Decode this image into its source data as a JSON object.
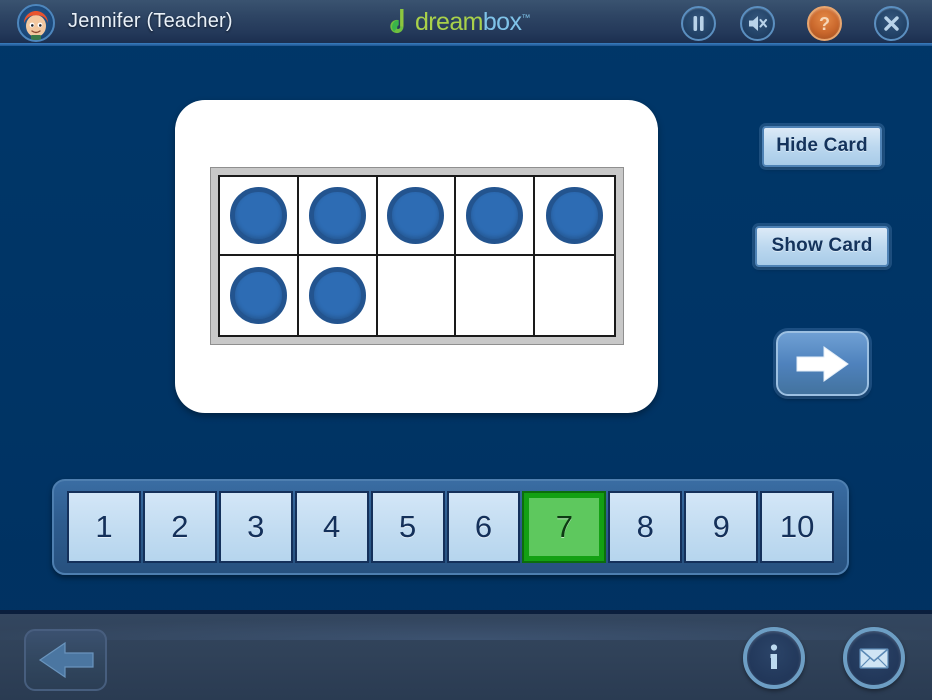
{
  "header": {
    "avatar_icon": "student-avatar-icon",
    "user_name": "Jennifer (Teacher)",
    "logo": {
      "mark_icon": "dreambox-d-icon",
      "text_dream": "dream",
      "text_box": "box",
      "trademark": "™"
    },
    "buttons": [
      {
        "name": "pause-button",
        "icon": "pause-icon",
        "label": "Pause"
      },
      {
        "name": "mute-button",
        "icon": "speaker-mute-icon",
        "label": "Mute"
      },
      {
        "name": "help-button",
        "icon": "question-mark-icon",
        "label": "Help"
      },
      {
        "name": "close-button",
        "icon": "close-x-icon",
        "label": "Close"
      }
    ]
  },
  "main": {
    "card": {
      "name": "ten-frame-card",
      "ten_frame": {
        "rows": 2,
        "columns": 5,
        "total_cells": 10,
        "filled_count": 7,
        "cells": [
          true,
          true,
          true,
          true,
          true,
          true,
          true,
          false,
          false,
          false
        ],
        "dot_color": "#2d6cb4",
        "dot_ring_color": "#23548f"
      }
    },
    "controls": {
      "hide_card_label": "Hide Card",
      "show_card_label": "Show Card",
      "next_icon": "arrow-right-icon",
      "next_label": "Next"
    }
  },
  "number_track": {
    "tiles": [
      "1",
      "2",
      "3",
      "4",
      "5",
      "6",
      "7",
      "8",
      "9",
      "10"
    ],
    "selected_value": "7",
    "selected_index": 6,
    "selected_border_color": "#13a013",
    "selected_fill_color": "#5ec85e",
    "tile_fill_color": "#c2dcf1"
  },
  "footer": {
    "back_icon": "arrow-left-icon",
    "back_label": "Back",
    "info_icon": "info-icon",
    "info_label": "Info",
    "mail_icon": "envelope-icon",
    "mail_label": "Messages"
  },
  "theme": {
    "background": "#003465",
    "header_bg": "#2d4463",
    "footer_bg": "#304259",
    "accent_blue": "#2f6ea8",
    "card_bg": "#ffffff",
    "help_orange": "#c9672c",
    "green_accent": "#13a013"
  }
}
